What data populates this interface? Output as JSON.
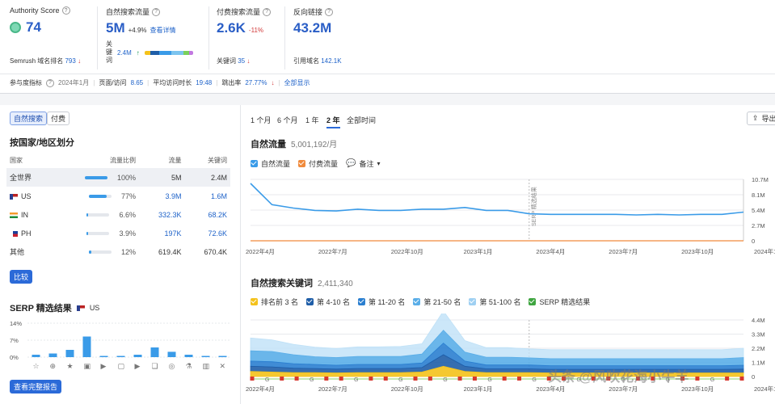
{
  "metrics": {
    "authority": {
      "label": "Authority Score",
      "value": "74",
      "rank_label": "Semrush 域名排名",
      "rank_value": "793"
    },
    "organic": {
      "label": "自然搜索流量",
      "value": "5M",
      "delta": "+4.9%",
      "link": "查看详情",
      "kw_label": "关键词",
      "kw_value": "2.4M"
    },
    "paid": {
      "label": "付费搜索流量",
      "value": "2.6K",
      "delta": "-11%",
      "kw_label": "关键词",
      "kw_value": "35"
    },
    "backlinks": {
      "label": "反向链接",
      "value": "43.2M",
      "ref_label": "引用域名",
      "ref_value": "142.1K"
    }
  },
  "engagement": {
    "label": "参与度指标",
    "date": "2024年1月",
    "pages_label": "页面/访问",
    "pages_value": "8.65",
    "duration_label": "平均访问时长",
    "duration_value": "19:48",
    "bounce_label": "跳出率",
    "bounce_value": "27.77%",
    "show_all": "全部显示"
  },
  "left": {
    "toggle": [
      "自然搜索",
      "付费"
    ],
    "country_title": "按国家/地区划分",
    "table_headers": [
      "国家",
      "流量比例",
      "流量",
      "关键词"
    ],
    "rows": [
      {
        "name": "全世界",
        "flag": "",
        "share": 100,
        "share_text": "100%",
        "traffic": "5M",
        "keywords": "2.4M",
        "selected": true
      },
      {
        "name": "US",
        "flag": "us",
        "share": 77,
        "share_text": "77%",
        "traffic": "3.9M",
        "keywords": "1.6M"
      },
      {
        "name": "IN",
        "flag": "in",
        "share": 6.6,
        "share_text": "6.6%",
        "traffic": "332.3K",
        "keywords": "68.2K"
      },
      {
        "name": "PH",
        "flag": "ph",
        "share": 3.9,
        "share_text": "3.9%",
        "traffic": "197K",
        "keywords": "72.6K"
      },
      {
        "name": "其他",
        "flag": "",
        "share": 12,
        "share_text": "12%",
        "traffic": "619.4K",
        "keywords": "670.4K"
      }
    ],
    "compare_btn": "比较",
    "serp_title": "SERP 精选结果",
    "serp_country": "US",
    "serp_yticks": [
      "14%",
      "7%",
      "0%"
    ],
    "serp_values": [
      1,
      1.5,
      3,
      8.5,
      0.3,
      0,
      1,
      4,
      2.2,
      1,
      0.5,
      0
    ],
    "serp_icons": [
      "☆",
      "⊕",
      "★",
      "▣",
      "▶",
      "▢",
      "▶",
      "❏",
      "◎",
      "⚗",
      "▥",
      "✕"
    ],
    "report_btn": "查看完整报告"
  },
  "right": {
    "ranges": [
      "1 个月",
      "6 个月",
      "1 年",
      "2 年",
      "全部时间"
    ],
    "active_range": "2 年",
    "export_label": "导出",
    "organic_title": "自然流量",
    "organic_value": "5,001,192/月",
    "legend1": [
      {
        "label": "自然流量",
        "color": "#3a9be8"
      },
      {
        "label": "付费流量",
        "color": "#f08a3c"
      }
    ],
    "notes_label": "备注",
    "yticks1": [
      "10.7M",
      "8.1M",
      "5.4M",
      "2.7M",
      "0"
    ],
    "xticks": [
      "2022年4月",
      "2022年7月",
      "2022年10月",
      "2023年1月",
      "2023年4月",
      "2023年7月",
      "2023年10月",
      "2024年1月"
    ],
    "serp_marker": "SERP 精选结果",
    "kw_title": "自然搜索关键词",
    "kw_value": "2,411,340",
    "legend2": [
      {
        "label": "排名前 3 名",
        "color": "#f4c21b"
      },
      {
        "label": "第 4-10 名",
        "color": "#1f5ea8"
      },
      {
        "label": "第 11-20 名",
        "color": "#2b7fd0"
      },
      {
        "label": "第 21-50 名",
        "color": "#5aaee8"
      },
      {
        "label": "第 51-100 名",
        "color": "#9fd0f2"
      },
      {
        "label": "SERP 精选结果",
        "color": "#3fa540"
      }
    ],
    "yticks2": [
      "4.4M",
      "3.3M",
      "2.2M",
      "1.1M",
      "0"
    ]
  },
  "watermark": "头条 @风吹花海小牛羊",
  "chart_data": [
    {
      "type": "line",
      "title": "自然流量",
      "x": [
        "2022-03",
        "2022-04",
        "2022-05",
        "2022-06",
        "2022-07",
        "2022-08",
        "2022-09",
        "2022-10",
        "2022-11",
        "2022-12",
        "2023-01",
        "2023-02",
        "2023-03",
        "2023-04",
        "2023-05",
        "2023-06",
        "2023-07",
        "2023-08",
        "2023-09",
        "2023-10",
        "2023-11",
        "2023-12",
        "2024-01",
        "2024-02"
      ],
      "series": [
        {
          "name": "自然流量",
          "values": [
            10.0,
            6.3,
            5.7,
            5.3,
            5.2,
            5.5,
            5.3,
            5.3,
            5.5,
            5.5,
            5.8,
            5.3,
            5.3,
            4.7,
            4.6,
            4.6,
            4.6,
            4.6,
            4.5,
            4.6,
            4.5,
            4.6,
            4.6,
            5.0
          ]
        },
        {
          "name": "付费流量",
          "values": [
            0,
            0,
            0,
            0,
            0,
            0,
            0,
            0,
            0,
            0,
            0,
            0,
            0,
            0,
            0,
            0,
            0,
            0,
            0,
            0,
            0,
            0,
            0,
            0
          ]
        }
      ],
      "ylim": [
        0,
        10.7
      ]
    },
    {
      "type": "area",
      "title": "自然搜索关键词",
      "x": [
        "2022-03",
        "2022-04",
        "2022-05",
        "2022-06",
        "2022-07",
        "2022-08",
        "2022-09",
        "2022-10",
        "2022-11",
        "2022-12",
        "2023-01",
        "2023-02",
        "2023-03",
        "2023-04",
        "2023-05",
        "2023-06",
        "2023-07",
        "2023-08",
        "2023-09",
        "2023-10",
        "2023-11",
        "2023-12",
        "2024-01",
        "2024-02"
      ],
      "series": [
        {
          "name": "排名前 3 名",
          "values": [
            0.4,
            0.35,
            0.3,
            0.3,
            0.28,
            0.3,
            0.3,
            0.3,
            0.35,
            0.8,
            0.4,
            0.3,
            0.3,
            0.3,
            0.28,
            0.28,
            0.28,
            0.28,
            0.28,
            0.28,
            0.28,
            0.28,
            0.28,
            0.28
          ]
        },
        {
          "name": "第 4-10 名",
          "values": [
            0.4,
            0.4,
            0.35,
            0.32,
            0.3,
            0.32,
            0.32,
            0.32,
            0.35,
            0.9,
            0.4,
            0.3,
            0.3,
            0.3,
            0.28,
            0.28,
            0.28,
            0.28,
            0.28,
            0.28,
            0.28,
            0.28,
            0.28,
            0.3
          ]
        },
        {
          "name": "第 11-20 名",
          "values": [
            0.4,
            0.4,
            0.35,
            0.32,
            0.3,
            0.32,
            0.32,
            0.32,
            0.35,
            0.9,
            0.4,
            0.3,
            0.3,
            0.3,
            0.28,
            0.28,
            0.28,
            0.28,
            0.28,
            0.28,
            0.28,
            0.28,
            0.28,
            0.3
          ]
        },
        {
          "name": "第 21-50 名",
          "values": [
            0.8,
            0.8,
            0.7,
            0.6,
            0.6,
            0.62,
            0.62,
            0.62,
            0.7,
            1.0,
            0.7,
            0.6,
            0.6,
            0.55,
            0.55,
            0.55,
            0.55,
            0.55,
            0.55,
            0.55,
            0.55,
            0.55,
            0.55,
            0.6
          ]
        },
        {
          "name": "第 51-100 名",
          "values": [
            1.0,
            0.9,
            0.8,
            0.75,
            0.7,
            0.75,
            0.75,
            0.78,
            0.8,
            1.5,
            0.9,
            0.75,
            0.75,
            0.7,
            0.7,
            0.7,
            0.7,
            0.7,
            0.7,
            0.7,
            0.7,
            0.7,
            0.7,
            0.72
          ]
        }
      ],
      "ylim": [
        0,
        4.4
      ]
    },
    {
      "type": "bar",
      "title": "SERP 精选结果",
      "ylim": [
        0,
        14
      ]
    }
  ]
}
